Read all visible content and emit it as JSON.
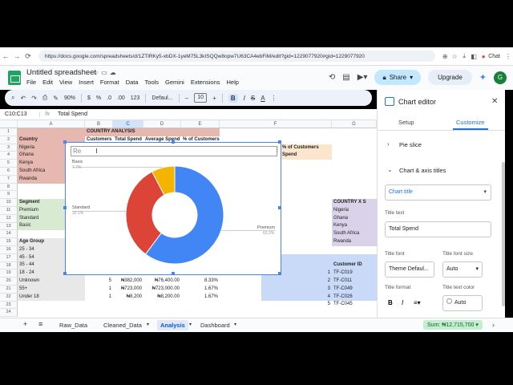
{
  "browser": {
    "url": "https://docs.google.com/spreadsheets/d/1ZTlRKy5-xbDX-1yeM75L3kISQQw8opw7U63CA4ebFiM/edit?gid=1229077920#gid=1229077920",
    "chat": "Chat"
  },
  "doc": {
    "title": "Untitled spreadsheet",
    "menus": [
      "File",
      "Edit",
      "View",
      "Insert",
      "Format",
      "Data",
      "Tools",
      "Gemini",
      "Extensions",
      "Help"
    ],
    "share": "Share",
    "upgrade": "Upgrade",
    "avatar": "G"
  },
  "toolbar": {
    "zoom": "90%",
    "currency": "$",
    "percent": "%",
    "dec_dec": ".0",
    "dec_inc": ".00",
    "num": "123",
    "font": "Defaul...",
    "fontsize": "10",
    "bold": "B",
    "italic": "I",
    "strike": "S",
    "textcolor": "A"
  },
  "formula": {
    "cell": "C10:C13",
    "fx": "fx",
    "value": "Total Spend"
  },
  "grid": {
    "columns": [
      "A",
      "B",
      "C",
      "D",
      "E",
      "F",
      "G"
    ],
    "rows": [
      "1",
      "2",
      "3",
      "4",
      "5",
      "6",
      "7",
      "8",
      "9",
      "10",
      "11",
      "12",
      "13",
      "14",
      "15",
      "16",
      "17",
      "18",
      "19",
      "20",
      "21",
      "22",
      "23",
      "24"
    ],
    "cells": {
      "a1": "COUNTRY ANALYSIS",
      "a2": "Country",
      "b2": "Customers",
      "c2": "Total Spend",
      "d2": "Average Spend",
      "e2": "% of Customers",
      "a3": "Nigeria",
      "a4": "Ghana",
      "a5": "Kenya",
      "a6": "South Africa",
      "a7": "Rwanda",
      "a10": "Segment",
      "a11": "Premium",
      "a12": "Standard",
      "a13": "Basic",
      "a16": "Age Group",
      "a17": "25 - 34",
      "a18": "45 - 54",
      "a19": "35 - 44",
      "a20": "18 - 24",
      "a21": "Unknown",
      "b21": "5",
      "c21": "₦382,000",
      "d21": "₦76,400.00",
      "e21": "8.33%",
      "a22": "55+",
      "b22": "1",
      "c22": "₦723,000",
      "d22": "₦723,000.00",
      "e22": "1.67%",
      "a23": "Under 18",
      "b23": "1",
      "c23": "₦8,200",
      "d23": "₦8,200.00",
      "e23": "1.67%",
      "f2": "% of Customers",
      "f3": "Spend",
      "f10": "COUNTRY X S",
      "f11": "Nigeria",
      "f12": "Ghana",
      "f13": "Kenya",
      "f14": "South Africa",
      "f15": "Rwanda",
      "f19": "Customer ID",
      "f20": "1",
      "g20": "TF-C019",
      "f21": "2",
      "g21": "TF-C011",
      "f22": "3",
      "g22": "TF-C049",
      "f23": "4",
      "g23": "TF-C026",
      "f24": "5",
      "g24": "TF-C045"
    }
  },
  "chart": {
    "title_input": "Re",
    "chart_data": {
      "type": "pie",
      "donut": true,
      "categories": [
        "Premium",
        "Standard",
        "Basic"
      ],
      "values": [
        60.2,
        32.1,
        7.7
      ],
      "labels": [
        "Premium",
        "Standard",
        "Basic"
      ],
      "percent_labels": [
        "60.2%",
        "32.1%",
        "7.7%"
      ],
      "colors": [
        "#4285f4",
        "#db4437",
        "#f4b400"
      ],
      "title": ""
    }
  },
  "sidebar": {
    "title": "Chart editor",
    "tab_setup": "Setup",
    "tab_customize": "Customize",
    "pie_slice": "Pie slice",
    "axis_titles": "Chart & axis titles",
    "title_select": "Chart title",
    "title_text_label": "Title text",
    "title_text_value": "Total Spend",
    "title_font_label": "Title font",
    "title_font_value": "Theme Defaul...",
    "title_size_label": "Title font size",
    "title_size_value": "Auto",
    "title_format_label": "Title format",
    "title_color_label": "Title text color",
    "title_color_value": "Auto"
  },
  "bottom": {
    "tabs": [
      "Raw_Data",
      "Cleaned_Data",
      "Analysis",
      "Dashboard"
    ],
    "sum": "Sum: ₦12,715,700"
  }
}
